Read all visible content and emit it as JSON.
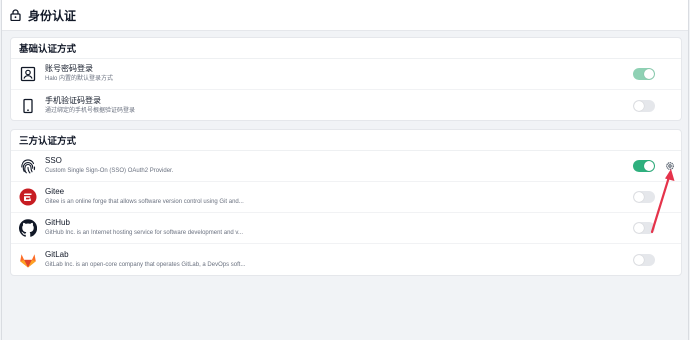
{
  "page": {
    "title": "身份认证"
  },
  "basic": {
    "title": "基础认证方式",
    "items": [
      {
        "name": "账号密码登录",
        "desc": "Halo 内置的默认登录方式",
        "enabled": true,
        "icon": "id-card-icon"
      },
      {
        "name": "手机验证码登录",
        "desc": "通过绑定的手机号根据验证码登录",
        "enabled": false,
        "icon": "phone-icon"
      }
    ]
  },
  "third": {
    "title": "三方认证方式",
    "items": [
      {
        "name": "SSO",
        "desc": "Custom Single Sign-On (SSO) OAuth2 Provider.",
        "enabled": true,
        "icon": "fingerprint-icon"
      },
      {
        "name": "Gitee",
        "desc": "Gitee is an online forge that allows software version control using Git and...",
        "enabled": false,
        "icon": "gitee-logo-icon"
      },
      {
        "name": "GitHub",
        "desc": "GitHub Inc. is an Internet hosting service for software development and v...",
        "enabled": false,
        "icon": "github-logo-icon"
      },
      {
        "name": "GitLab",
        "desc": "GitLab Inc. is an open-core company that operates GitLab, a DevOps soft...",
        "enabled": false,
        "icon": "gitlab-logo-icon"
      }
    ]
  },
  "colors": {
    "toggle_on": "#2fb07e",
    "toggle_on_soft": "#8fd1b4",
    "toggle_off": "#e5e7eb",
    "arrow": "#e5334b"
  }
}
